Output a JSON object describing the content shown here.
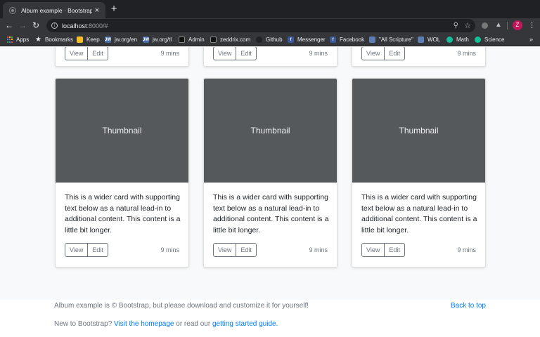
{
  "browser": {
    "tab_title": "Album example · Bootstrap",
    "tab_close": "×",
    "new_tab": "+",
    "nav": {
      "back": "←",
      "forward": "→",
      "reload": "↻"
    },
    "url_host": "localhost",
    "url_rest": ":8000/#",
    "info_glyph": "i",
    "zoom_glyph": "⚲",
    "star_glyph": "☆",
    "ext2_glyph": "▲",
    "profile_initial": "Z",
    "menu_glyph": "⋮",
    "profile_color": "#c2185b"
  },
  "bookmarks": {
    "items": [
      {
        "label": "Apps",
        "icon": "apps-grid-icon"
      },
      {
        "label": "Bookmarks",
        "icon": "star-icon"
      },
      {
        "label": "Keep",
        "icon": "keep-icon"
      },
      {
        "label": "jw.org/en",
        "icon": "jw-icon"
      },
      {
        "label": "jw.org/tl",
        "icon": "jw-icon"
      },
      {
        "label": "Admin",
        "icon": "admin-icon"
      },
      {
        "label": "zeddrix.com",
        "icon": "site-icon"
      },
      {
        "label": "Github",
        "icon": "github-icon"
      },
      {
        "label": "Messenger",
        "icon": "facebook-icon"
      },
      {
        "label": "Facebook",
        "icon": "facebook-icon"
      },
      {
        "label": "\"All Scripture\"",
        "icon": "wol-icon"
      },
      {
        "label": "WOL",
        "icon": "wol-icon"
      },
      {
        "label": "Math",
        "icon": "khan-icon"
      },
      {
        "label": "Science",
        "icon": "khan-icon"
      }
    ],
    "more": "»"
  },
  "album": {
    "top_cards": [
      {
        "view": "View",
        "edit": "Edit",
        "mins": "9 mins"
      },
      {
        "view": "View",
        "edit": "Edit",
        "mins": "9 mins"
      },
      {
        "view": "View",
        "edit": "Edit",
        "mins": "9 mins"
      }
    ],
    "cards": [
      {
        "thumbnail": "Thumbnail",
        "text": "This is a wider card with supporting text below as a natural lead-in to additional content. This content is a little bit longer.",
        "view": "View",
        "edit": "Edit",
        "mins": "9 mins"
      },
      {
        "thumbnail": "Thumbnail",
        "text": "This is a wider card with supporting text below as a natural lead-in to additional content. This content is a little bit longer.",
        "view": "View",
        "edit": "Edit",
        "mins": "9 mins"
      },
      {
        "thumbnail": "Thumbnail",
        "text": "This is a wider card with supporting text below as a natural lead-in to additional content. This content is a little bit longer.",
        "view": "View",
        "edit": "Edit",
        "mins": "9 mins"
      }
    ]
  },
  "footer": {
    "line1": "Album example is © Bootstrap, but please download and customize it for yourself!",
    "back_to_top": "Back to top",
    "line2_prefix": "New to Bootstrap?",
    "homepage_link": "Visit the homepage",
    "line2_mid": "or read our",
    "guide_link": "getting started guide."
  },
  "colors": {
    "thumbnail_bg": "#55595c",
    "link": "#007bff",
    "muted": "#6c757d",
    "album_bg": "#f8f9fa"
  }
}
